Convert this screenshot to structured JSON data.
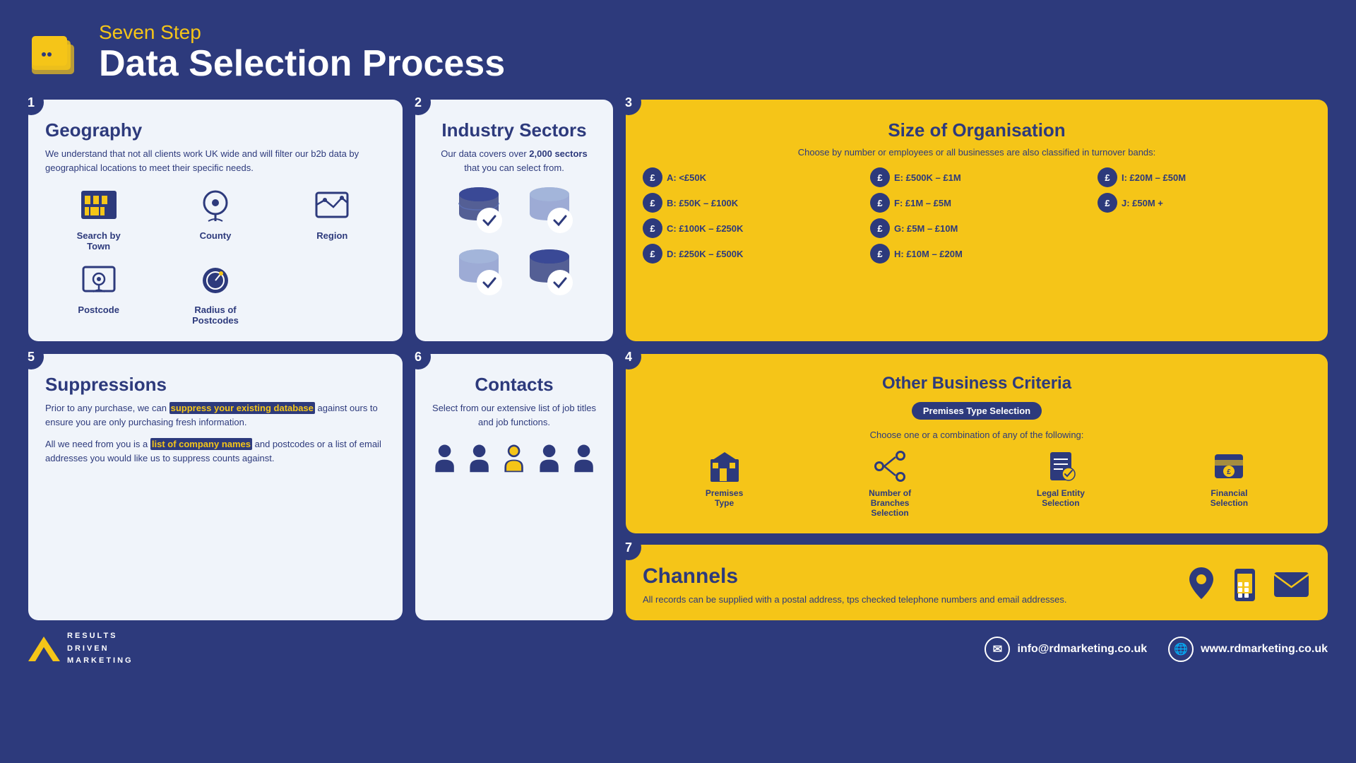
{
  "header": {
    "subtitle": "Seven Step",
    "title": "Data Selection Process"
  },
  "steps": {
    "s1": {
      "number": "1",
      "title": "Geography",
      "body": "We understand that not all clients work UK wide and will filter our b2b data by geographical locations to meet their specific needs.",
      "icons": [
        {
          "name": "Search by Town",
          "icon": "building"
        },
        {
          "name": "County",
          "icon": "map-pin"
        },
        {
          "name": "Region",
          "icon": "region"
        },
        {
          "name": "Postcode",
          "icon": "postcode"
        },
        {
          "name": "Radius of Postcodes",
          "icon": "radius"
        }
      ]
    },
    "s2": {
      "number": "2",
      "title": "Industry Sectors",
      "subtitle": "Our data covers over 2,000 sectors that you can select from.",
      "highlight": "2,000"
    },
    "s3": {
      "number": "3",
      "title": "Size of Organisation",
      "subtitle": "Choose by number or employees or all businesses are also classified in turnover bands:",
      "bands": [
        {
          "label": "A: <£50K"
        },
        {
          "label": "E: £500K – £1M"
        },
        {
          "label": "I: £20M – £50M"
        },
        {
          "label": "B: £50K – £100K"
        },
        {
          "label": "F: £1M – £5M"
        },
        {
          "label": "J: £50M +"
        },
        {
          "label": "C: £100K – £250K"
        },
        {
          "label": "G: £5M – £10M"
        },
        {
          "label": ""
        },
        {
          "label": "D: £250K – £500K"
        },
        {
          "label": "H: £10M – £20M"
        },
        {
          "label": ""
        }
      ]
    },
    "s4": {
      "number": "4",
      "title": "Other Business Criteria",
      "badge": "Premises Type Selection",
      "subtitle": "Choose one or a combination of any of the following:",
      "icons": [
        {
          "name": "Premises Type"
        },
        {
          "name": "Number of Branches Selection"
        },
        {
          "name": "Legal Entity Selection"
        },
        {
          "name": "Financial Selection"
        }
      ]
    },
    "s5": {
      "number": "5",
      "title": "Suppressions",
      "body1": "Prior to any purchase, we can",
      "highlight": "suppress your existing database",
      "body2": "against ours to ensure you are only purchasing fresh information.",
      "body3": "All we need from you is a",
      "highlight2": "list of company names",
      "body4": "and postcodes or a list of email addresses you would like us to suppress counts against."
    },
    "s6": {
      "number": "6",
      "title": "Contacts",
      "subtitle": "Select from our extensive list of job titles and job functions."
    },
    "s7": {
      "number": "7",
      "title": "Channels",
      "body": "All records can be supplied with a postal address, tps checked telephone numbers and email addresses."
    }
  },
  "footer": {
    "logo_lines": [
      "RESULTS",
      "DRIVEN",
      "MARKETING"
    ],
    "email": "info@rdmarketing.co.uk",
    "website": "www.rdmarketing.co.uk"
  }
}
